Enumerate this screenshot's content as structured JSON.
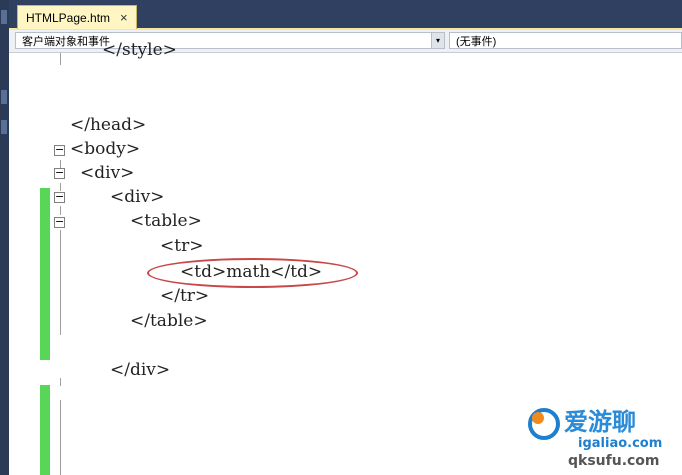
{
  "tab": {
    "title": "HTMLPage.htm",
    "close": "×"
  },
  "navbar": {
    "left_combo": "客户端对象和事件",
    "right_combo": "(无事件)"
  },
  "code_lines": [
    "</style>",
    "</head>",
    "<body>",
    "<div>",
    "<div>",
    "<table>",
    "<tr>",
    "<td>math</td>",
    "</tr>",
    "</table>",
    "</div>"
  ],
  "watermark": {
    "line1": "爱游聊",
    "url": "igaliao.com",
    "domain": "qksufu.com"
  },
  "colors": {
    "change_bar": "#58d658",
    "highlight_ellipse": "#c84848",
    "tab_bg": "#fff6c3"
  }
}
